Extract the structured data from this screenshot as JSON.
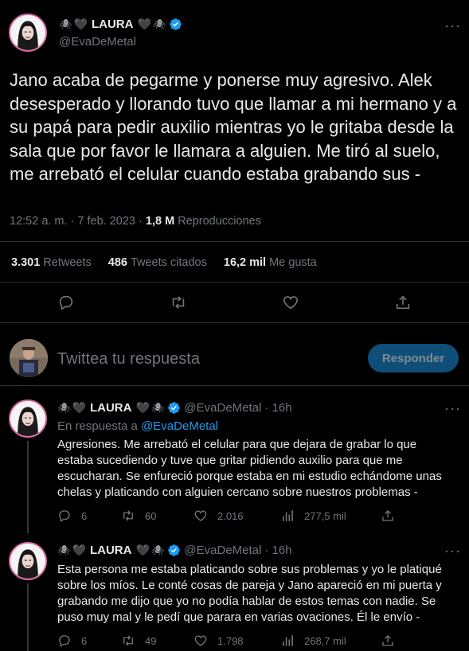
{
  "main": {
    "name": "LAURA",
    "handle": "@EvaDeMetal",
    "text": "Jano acaba de pegarme y ponerse muy agresivo. Alek desesperado y llorando tuvo que llamar a mi hermano y a su papá para pedir auxilio mientras yo le gritaba desde la sala que por favor le llamara a alguien. Me tiró al suelo, me arrebató el celular cuando estaba grabando sus -",
    "time": "12:52 a. m. · 7 feb. 2023 ·",
    "views": "1,8 M",
    "views_label": "Reproducciones",
    "retweets": "3.301",
    "retweets_label": "Retweets",
    "quotes": "486",
    "quotes_label": "Tweets citados",
    "likes": "16,2 mil",
    "likes_label": "Me gusta"
  },
  "compose": {
    "placeholder": "Twittea tu respuesta",
    "button": "Responder"
  },
  "replies": [
    {
      "name": "LAURA",
      "handle": "@EvaDeMetal",
      "time": "· 16h",
      "in_reply_prefix": "En respuesta a",
      "in_reply_handle": "@EvaDeMetal",
      "text": "Agresiones. Me arrebató el celular para que dejara de grabar lo que estaba sucediendo y tuve que gritar pidiendo auxilio para que me escucharan. Se enfureció porque estaba en mi estudio echándome unas chelas y platicando con alguien cercano sobre nuestros problemas -",
      "replies": "6",
      "retweets": "60",
      "likes": "2.016",
      "views": "277,5 mil"
    },
    {
      "name": "LAURA",
      "handle": "@EvaDeMetal",
      "time": "· 16h",
      "text": "Esta persona me estaba platicando sobre sus problemas y yo le platiqué sobre los míos. Le conté cosas de pareja y Jano apareció en mi puerta y grabando me dijo que yo no podía hablar de estos temas con nadie. Se puso muy mal y le pedí que parara en varias ovaciones. Él le envío -",
      "replies": "6",
      "retweets": "49",
      "likes": "1.798",
      "views": "268,7 mil"
    }
  ],
  "colors": {
    "background": "#000000",
    "text": "#e7e9ea",
    "muted": "#71767b",
    "accent": "#1d9bf0",
    "divider": "#2f3336"
  }
}
